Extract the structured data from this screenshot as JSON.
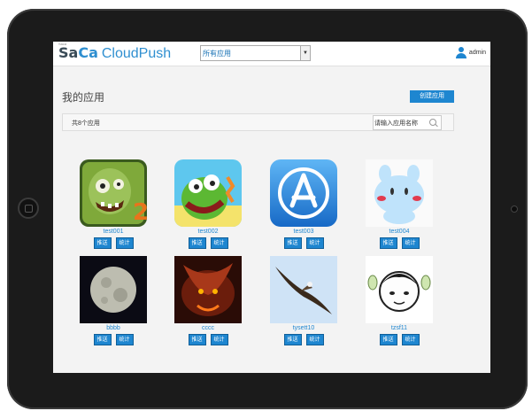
{
  "header": {
    "logo_small": "Saca",
    "logo_main_a": "Sa",
    "logo_main_b": "Ca",
    "logo_product": "CloudPush",
    "app_select": "所有应用",
    "username": "admin"
  },
  "page": {
    "title": "我的应用",
    "create_label": "创建应用",
    "count_text": "共8个应用",
    "search_placeholder": "请输入应用名称"
  },
  "apps": [
    {
      "name": "test001",
      "push": "推送",
      "stats": "统计",
      "icon": "zombie-icon"
    },
    {
      "name": "test002",
      "push": "推送",
      "stats": "统计",
      "icon": "monster-icon"
    },
    {
      "name": "test003",
      "push": "推送",
      "stats": "统计",
      "icon": "app-store-icon"
    },
    {
      "name": "test004",
      "push": "推送",
      "stats": "统计",
      "icon": "bunny-icon"
    },
    {
      "name": "bbbb",
      "push": "推送",
      "stats": "统计",
      "icon": "moon-icon"
    },
    {
      "name": "cccc",
      "push": "推送",
      "stats": "统计",
      "icon": "dragon-icon"
    },
    {
      "name": "tysett10",
      "push": "推送",
      "stats": "统计",
      "icon": "eagle-icon"
    },
    {
      "name": "tzsf11",
      "push": "推送",
      "stats": "统计",
      "icon": "cartoon-face-icon"
    }
  ],
  "colors": {
    "accent": "#1e86d0",
    "frame": "#1b1b1b"
  }
}
